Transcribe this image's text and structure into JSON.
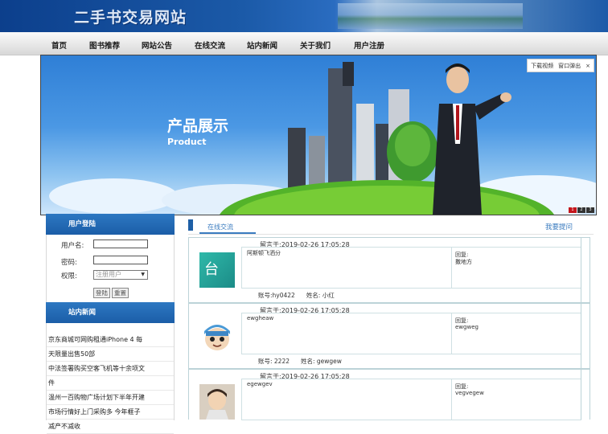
{
  "site": {
    "title": "二手书交易网站"
  },
  "nav": {
    "items": [
      "首页",
      "图书推荐",
      "网站公告",
      "在线交流",
      "站内新闻",
      "关于我们",
      "用户注册"
    ]
  },
  "banner": {
    "title": "产品展示",
    "subtitle": "Product",
    "tools": {
      "download": "下载视频",
      "popup": "窗口弹出",
      "close": "×"
    },
    "pager": [
      "1",
      "2",
      "3"
    ]
  },
  "login": {
    "header": "用户登陆",
    "username_label": "用户名:",
    "password_label": "密码:",
    "role_label": "权限:",
    "role_value": "注册用户",
    "login_button": "登陆",
    "reset_button": "重置"
  },
  "news": {
    "header": "站内新闻",
    "items": [
      "京东商城可网购租通iPhone 4 每",
      "天限量出售50部",
      "中法签署购买空客飞机等十余项文",
      "件",
      "温州一百购物广场计划下半年开建",
      "市场行情好上门采购多 今年榧子",
      "减产不减收"
    ]
  },
  "forum": {
    "tab": "在线交流",
    "ask": "我要提问",
    "posts": [
      {
        "time": "留言于:2019-02-26 17:05:28",
        "avatar_text": "台",
        "content": "阿斯顿飞洒分",
        "reply_label": "回复:",
        "reply": "撒地方",
        "account": "账号:hy0422",
        "name": "姓名: 小红"
      },
      {
        "time": "留言于:2019-02-26 17:05:28",
        "avatar_text": "",
        "content": "ewgheaw",
        "reply_label": "回复:",
        "reply": "ewgweg",
        "account": "账号: 2222",
        "name": "姓名: gewgew"
      },
      {
        "time": "留言于:2019-02-26 17:05:28",
        "avatar_text": "",
        "content": "egewgev",
        "reply_label": "回复:",
        "reply": "vegvegew",
        "account": "",
        "name": ""
      }
    ]
  },
  "colors": {
    "primary": "#1b5ea8",
    "accent": "#3a7bbf",
    "nav_bg": "#e6e6e6"
  }
}
